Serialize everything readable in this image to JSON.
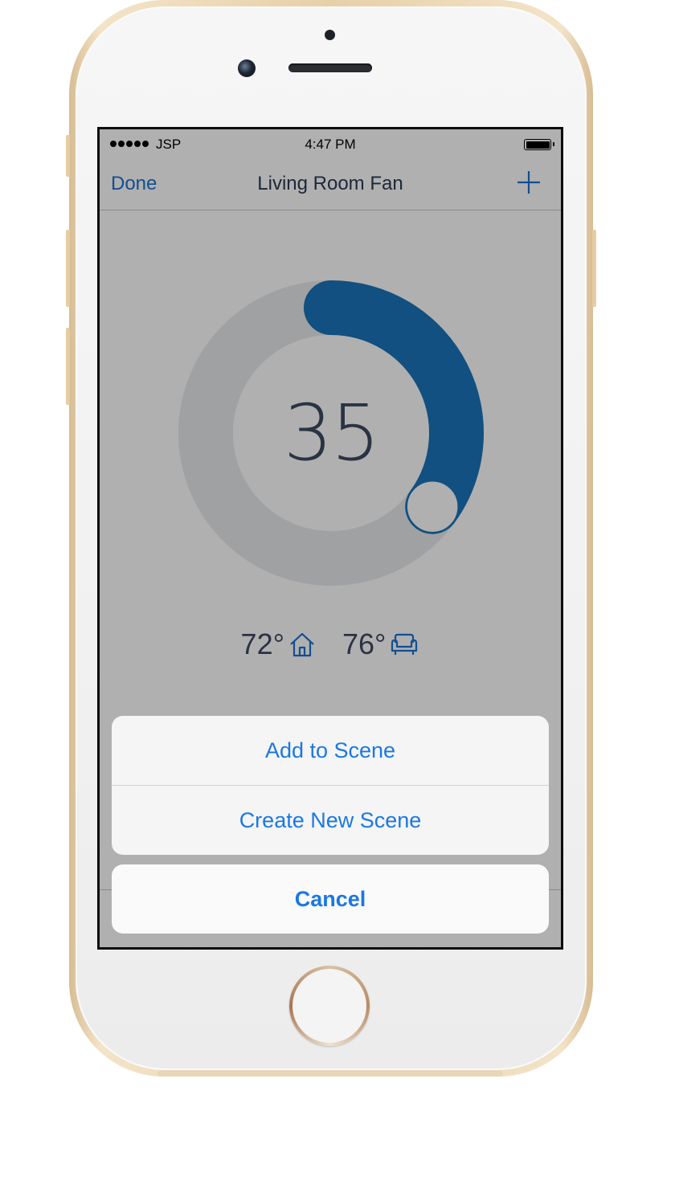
{
  "status_bar": {
    "carrier": "JSP",
    "time": "4:47 PM"
  },
  "nav": {
    "done_label": "Done",
    "title": "Living Room Fan",
    "add_icon": "plus-icon"
  },
  "dial": {
    "value": "35",
    "level_fraction": 0.35,
    "colors": {
      "track": "#e6e9ec",
      "fill": "#1a74ba",
      "knob": "#ffffff"
    }
  },
  "temperatures": {
    "indoor": "72°",
    "indoor_icon": "house-icon",
    "outdoor": "76°",
    "outdoor_icon": "armchair-icon"
  },
  "action_sheet": {
    "add_to_scene": "Add to Scene",
    "create_new_scene": "Create New Scene",
    "cancel": "Cancel"
  },
  "colors": {
    "accent": "#1a78e4",
    "title": "#2b3a55"
  }
}
